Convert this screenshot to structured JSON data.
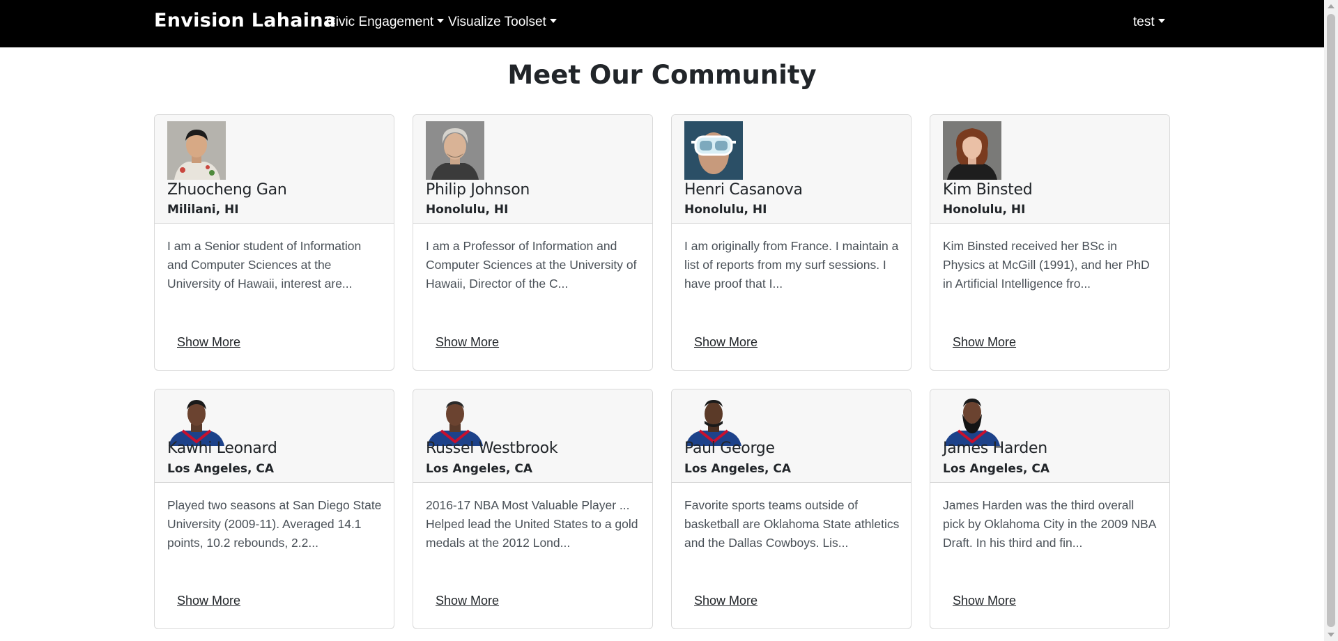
{
  "navbar": {
    "brand": "Envision Lahaina",
    "menus": [
      {
        "label": "Civic Engagement"
      },
      {
        "label": "Visualize Toolset"
      }
    ],
    "user": "test"
  },
  "page": {
    "title": "Meet Our Community"
  },
  "profiles": [
    {
      "name": "Zhuocheng Gan",
      "location": "Mililani, HI",
      "bio": "I am a Senior student of Information and Computer Sciences at the University of Hawaii, interest are...",
      "show_more": "Show More"
    },
    {
      "name": "Philip Johnson",
      "location": "Honolulu, HI",
      "bio": "I am a Professor of Information and Computer Sciences at the University of Hawaii, Director of the C...",
      "show_more": "Show More"
    },
    {
      "name": "Henri Casanova",
      "location": "Honolulu, HI",
      "bio": "I am originally from France. I maintain a list of reports from my surf sessions. I have proof that I...",
      "show_more": "Show More"
    },
    {
      "name": "Kim Binsted",
      "location": "Honolulu, HI",
      "bio": "Kim Binsted received her BSc in Physics at McGill (1991), and her PhD in Artificial Intelligence fro...",
      "show_more": "Show More"
    },
    {
      "name": "Kawhi Leonard",
      "location": "Los Angeles, CA",
      "bio": "Played two seasons at San Diego State University (2009-11). Averaged 14.1 points, 10.2 rebounds, 2.2...",
      "show_more": "Show More"
    },
    {
      "name": "Russel Westbrook",
      "location": "Los Angeles, CA",
      "bio": "2016-17 NBA Most Valuable Player ... Helped lead the United States to a gold medals at the 2012 Lond...",
      "show_more": "Show More"
    },
    {
      "name": "Paul George",
      "location": "Los Angeles, CA",
      "bio": "Favorite sports teams outside of basketball are Oklahoma State athletics and the Dallas Cowboys. Lis...",
      "show_more": "Show More"
    },
    {
      "name": "James Harden",
      "location": "Los Angeles, CA",
      "bio": "James Harden was the third overall pick by Oklahoma City in the 2009 NBA Draft. In his third and fin...",
      "show_more": "Show More"
    }
  ]
}
